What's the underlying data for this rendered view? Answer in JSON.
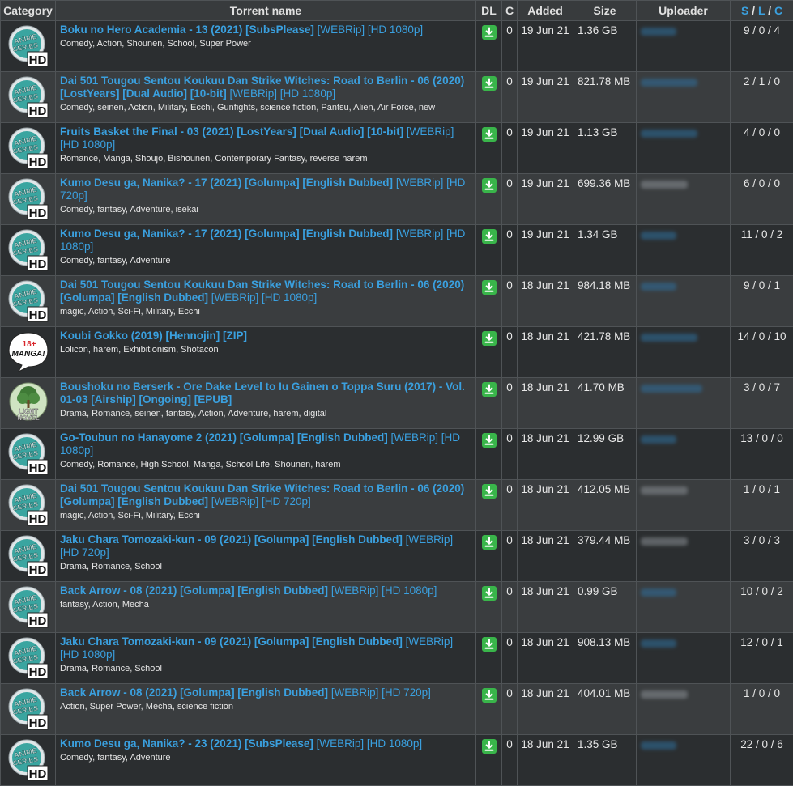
{
  "headers": {
    "category": "Category",
    "name": "Torrent name",
    "dl": "DL",
    "c": "C",
    "added": "Added",
    "size": "Size",
    "uploader": "Uploader",
    "slc_s": "S",
    "slc_l": "L",
    "slc_c": "C",
    "slc_sep": " / "
  },
  "badges": {
    "anime_line1": "ANIME",
    "anime_line2": "SERIES",
    "anime_hd": "HD",
    "manga_top": "18+",
    "manga_bottom": "MANGA!",
    "novel_line1": "LIGHT",
    "novel_line2": "NOVEL"
  },
  "colors": {
    "accent": "#3aa0df",
    "download": "#39b54a",
    "row_odd": "#2b2e30",
    "row_even": "#3a3d3f"
  },
  "rows": [
    {
      "cat": "anime",
      "title": "Boku no Hero Academia - 13 (2021) [SubsPlease]",
      "quality": "[WEBRip] [HD 1080p]",
      "tags": "Comedy, Action, Shounen, School, Super Power",
      "c": "0",
      "added": "19 Jun 21",
      "size": "1.36",
      "unit": "GB",
      "uploader_w": 44,
      "uploader_grey": false,
      "slc": "9 / 0 / 4"
    },
    {
      "cat": "anime",
      "title": "Dai 501 Tougou Sentou Koukuu Dan Strike Witches: Road to Berlin - 06 (2020) [LostYears] [Dual Audio] [10-bit]",
      "quality": "[WEBRip] [HD 1080p]",
      "tags": "Comedy, seinen, Action, Military, Ecchi, Gunfights, science fiction, Pantsu, Alien, Air Force, new",
      "c": "0",
      "added": "19 Jun 21",
      "size": "821.78",
      "unit": "MB",
      "uploader_w": 70,
      "uploader_grey": false,
      "slc": "2 / 1 / 0"
    },
    {
      "cat": "anime",
      "title": "Fruits Basket the Final - 03 (2021) [LostYears] [Dual Audio] [10-bit]",
      "quality": "[WEBRip] [HD 1080p]",
      "tags": "Romance, Manga, Shoujo, Bishounen, Contemporary Fantasy, reverse harem",
      "c": "0",
      "added": "19 Jun 21",
      "size": "1.13",
      "unit": "GB",
      "uploader_w": 70,
      "uploader_grey": false,
      "slc": "4 / 0 / 0"
    },
    {
      "cat": "anime",
      "title": "Kumo Desu ga, Nanika? - 17 (2021) [Golumpa] [English Dubbed]",
      "quality": "[WEBRip] [HD 720p]",
      "tags": "Comedy, fantasy, Adventure, isekai",
      "c": "0",
      "added": "19 Jun 21",
      "size": "699.36",
      "unit": "MB",
      "uploader_w": 58,
      "uploader_grey": true,
      "slc": "6 / 0 / 0"
    },
    {
      "cat": "anime",
      "title": "Kumo Desu ga, Nanika? - 17 (2021) [Golumpa] [English Dubbed]",
      "quality": "[WEBRip] [HD 1080p]",
      "tags": "Comedy, fantasy, Adventure",
      "c": "0",
      "added": "19 Jun 21",
      "size": "1.34",
      "unit": "GB",
      "uploader_w": 44,
      "uploader_grey": false,
      "slc": "11 / 0 / 2"
    },
    {
      "cat": "anime",
      "title": "Dai 501 Tougou Sentou Koukuu Dan Strike Witches: Road to Berlin - 06 (2020) [Golumpa] [English Dubbed]",
      "quality": "[WEBRip] [HD 1080p]",
      "tags": "magic, Action, Sci-Fi, Military, Ecchi",
      "c": "0",
      "added": "18 Jun 21",
      "size": "984.18",
      "unit": "MB",
      "uploader_w": 44,
      "uploader_grey": false,
      "slc": "9 / 0 / 1"
    },
    {
      "cat": "manga",
      "title": "Koubi Gokko (2019) [Hennojin] [ZIP]",
      "quality": "",
      "tags": "Lolicon, harem, Exhibitionism, Shotacon",
      "c": "0",
      "added": "18 Jun 21",
      "size": "421.78",
      "unit": "MB",
      "uploader_w": 70,
      "uploader_grey": false,
      "slc": "14 / 0 / 10"
    },
    {
      "cat": "novel",
      "title": "Boushoku no Berserk - Ore Dake Level to Iu Gainen o Toppa Suru (2017) - Vol. 01-03 [Airship] [Ongoing] [EPUB]",
      "quality": "",
      "tags": "Drama, Romance, seinen, fantasy, Action, Adventure, harem, digital",
      "c": "0",
      "added": "18 Jun 21",
      "size": "41.70",
      "unit": "MB",
      "uploader_w": 76,
      "uploader_grey": false,
      "slc": "3 / 0 / 7"
    },
    {
      "cat": "anime",
      "title": "Go-Toubun no Hanayome 2 (2021) [Golumpa] [English Dubbed]",
      "quality": "[WEBRip] [HD 1080p]",
      "tags": "Comedy, Romance, High School, Manga, School Life, Shounen, harem",
      "c": "0",
      "added": "18 Jun 21",
      "size": "12.99",
      "unit": "GB",
      "uploader_w": 44,
      "uploader_grey": false,
      "slc": "13 / 0 / 0"
    },
    {
      "cat": "anime",
      "title": "Dai 501 Tougou Sentou Koukuu Dan Strike Witches: Road to Berlin - 06 (2020) [Golumpa] [English Dubbed]",
      "quality": "[WEBRip] [HD 720p]",
      "tags": "magic, Action, Sci-Fi, Military, Ecchi",
      "c": "0",
      "added": "18 Jun 21",
      "size": "412.05",
      "unit": "MB",
      "uploader_w": 58,
      "uploader_grey": true,
      "slc": "1 / 0 / 1"
    },
    {
      "cat": "anime",
      "title": "Jaku Chara Tomozaki-kun - 09 (2021) [Golumpa] [English Dubbed]",
      "quality": "[WEBRip] [HD 720p]",
      "tags": "Drama, Romance, School",
      "c": "0",
      "added": "18 Jun 21",
      "size": "379.44",
      "unit": "MB",
      "uploader_w": 58,
      "uploader_grey": true,
      "slc": "3 / 0 / 3"
    },
    {
      "cat": "anime",
      "title": "Back Arrow - 08 (2021) [Golumpa] [English Dubbed]",
      "quality": "[WEBRip] [HD 1080p]",
      "tags": "fantasy, Action, Mecha",
      "c": "0",
      "added": "18 Jun 21",
      "size": "0.99",
      "unit": "GB",
      "uploader_w": 44,
      "uploader_grey": false,
      "slc": "10 / 0 / 2"
    },
    {
      "cat": "anime",
      "title": "Jaku Chara Tomozaki-kun - 09 (2021) [Golumpa] [English Dubbed]",
      "quality": "[WEBRip] [HD 1080p]",
      "tags": "Drama, Romance, School",
      "c": "0",
      "added": "18 Jun 21",
      "size": "908.13",
      "unit": "MB",
      "uploader_w": 44,
      "uploader_grey": false,
      "slc": "12 / 0 / 1"
    },
    {
      "cat": "anime",
      "title": "Back Arrow - 08 (2021) [Golumpa] [English Dubbed]",
      "quality": "[WEBRip] [HD 720p]",
      "tags": "Action, Super Power, Mecha, science fiction",
      "c": "0",
      "added": "18 Jun 21",
      "size": "404.01",
      "unit": "MB",
      "uploader_w": 58,
      "uploader_grey": true,
      "slc": "1 / 0 / 0"
    },
    {
      "cat": "anime",
      "title": "Kumo Desu ga, Nanika? - 23 (2021) [SubsPlease]",
      "quality": "[WEBRip] [HD 1080p]",
      "tags": "Comedy, fantasy, Adventure",
      "c": "0",
      "added": "18 Jun 21",
      "size": "1.35",
      "unit": "GB",
      "uploader_w": 44,
      "uploader_grey": false,
      "slc": "22 / 0 / 6"
    }
  ]
}
